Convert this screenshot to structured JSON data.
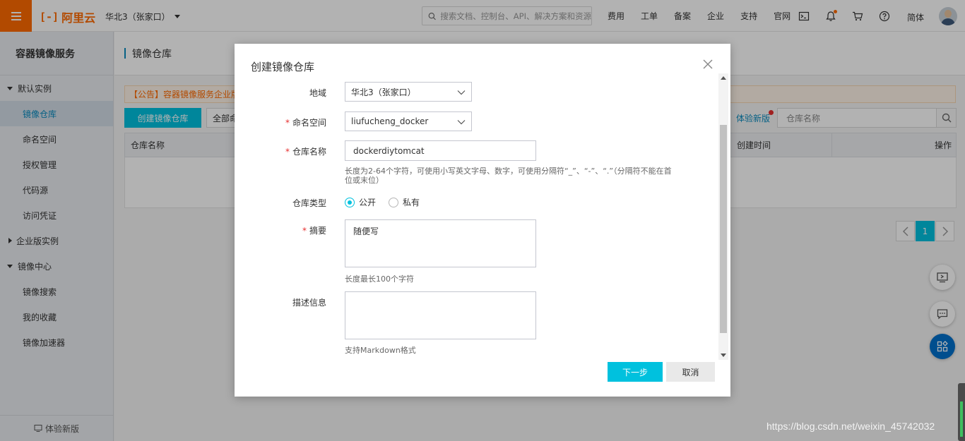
{
  "header": {
    "logo_text": "阿里云",
    "logo_mark": "[-]",
    "region": "华北3（张家口）",
    "search_placeholder": "搜索文档、控制台、API、解决方案和资源",
    "links": [
      "费用",
      "工单",
      "备案",
      "企业",
      "支持",
      "官网"
    ],
    "lang": "简体",
    "brand_color": "#ff6a00"
  },
  "sidebar": {
    "title": "容器镜像服务",
    "groups": [
      {
        "label": "默认实例",
        "expanded": true,
        "items": [
          "镜像仓库",
          "命名空间",
          "授权管理",
          "代码源",
          "访问凭证"
        ]
      },
      {
        "label": "企业版实例",
        "expanded": false,
        "items": []
      },
      {
        "label": "镜像中心",
        "expanded": true,
        "items": [
          "镜像搜索",
          "我的收藏",
          "镜像加速器"
        ]
      }
    ],
    "active_item": "镜像仓库",
    "footer": "体验新版"
  },
  "main": {
    "page_title": "镜像仓库",
    "notice": "【公告】容器镜像服务企业版",
    "create_button": "创建镜像仓库",
    "namespace_select": "全部命",
    "new_version": "体验新版",
    "search_placeholder": "仓库名称",
    "table_headers": [
      "仓库名称",
      "创建时间",
      "操作"
    ],
    "pager": {
      "current": "1"
    }
  },
  "modal": {
    "title": "创建镜像仓库",
    "fields": {
      "region": {
        "label": "地域",
        "value": "华北3（张家口）"
      },
      "namespace": {
        "label": "命名空间",
        "value": "liufucheng_docker"
      },
      "repo_name": {
        "label": "仓库名称",
        "value": "dockerdiytomcat",
        "hint_line1": "长度为2-64个字符，可使用小写英文字母、数字，可使用分隔符“_”、“-”、“.”（分隔符不能在首",
        "hint_line2": "位或末位）"
      },
      "repo_type": {
        "label": "仓库类型",
        "options": [
          "公开",
          "私有"
        ],
        "selected": "公开"
      },
      "summary": {
        "label": "摘要",
        "value": "随便写",
        "hint": "长度最长100个字符"
      },
      "description": {
        "label": "描述信息",
        "value": "",
        "hint": "支持Markdown格式"
      }
    },
    "next_button": "下一步",
    "cancel_button": "取消",
    "accent_color": "#00c1de"
  },
  "watermark": "https://blog.csdn.net/weixin_45742032"
}
